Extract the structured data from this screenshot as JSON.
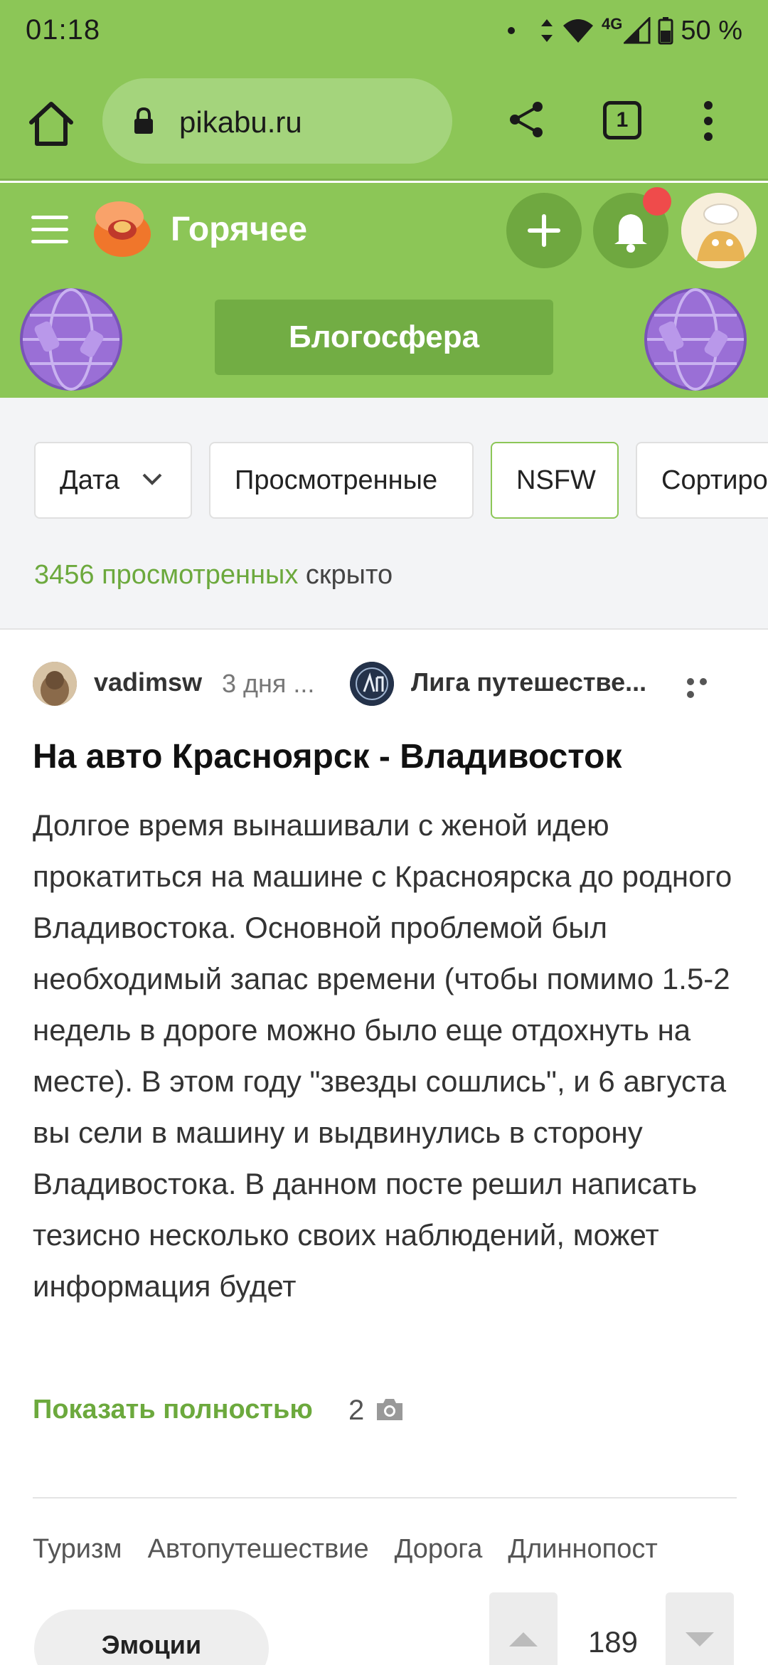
{
  "status_bar": {
    "time": "01:18",
    "network": "4G",
    "battery": "50 %"
  },
  "browser": {
    "url": "pikabu.ru",
    "tab_count": "1"
  },
  "header": {
    "title": "Горячее",
    "banner": "Блогосфера"
  },
  "filters": {
    "items": [
      "Дата",
      "Просмотренные",
      "NSFW",
      "Сортиро"
    ],
    "active": "NSFW",
    "hidden_link": "3456 просмотренных",
    "hidden_suffix": "скрыто"
  },
  "post": {
    "author": "vadimsw",
    "date": "3 дня ...",
    "community": "Лига путешестве...",
    "title": "На авто Красноярск - Владивосток",
    "body": "Долгое время вынашивали с женой идею прокатиться на машине с Красноярска до родного Владивостока. Основной проблемой был необходимый запас времени (чтобы помимо 1.5-2 недель в дороге можно было еще отдохнуть на месте). В этом году \"звезды сошлись\", и 6 августа вы сели в машину и выдвинулись в сторону Владивостока. В данном посте решил написать тезисно несколько своих наблюдений, может информация будет",
    "show_more": "Показать полностью",
    "image_count": "2",
    "tags": [
      "Туризм",
      "Автопутешествие",
      "Дорога",
      "Длиннопост"
    ],
    "emotions_label": "Эмоции",
    "rating": "189"
  },
  "colors": {
    "brand_green": "#8cc657",
    "link_green": "#6ca93d",
    "notification_red": "#ef4b4b"
  }
}
